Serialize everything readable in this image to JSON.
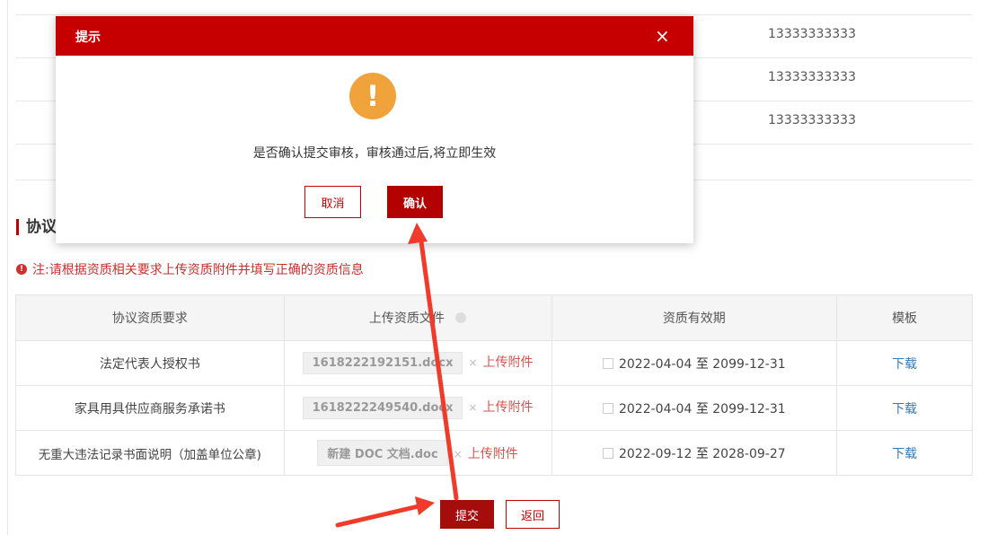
{
  "phones": [
    "13333333333",
    "13333333333",
    "13333333333"
  ],
  "section_title": "协议",
  "note": "注:请根据资质相关要求上传资质附件并填写正确的资质信息",
  "table": {
    "headers": [
      "协议资质要求",
      "上传资质文件",
      "资质有效期",
      "模板"
    ],
    "rows": [
      {
        "req": "法定代表人授权书",
        "file": "1618222192151.docx",
        "upload": "上传附件",
        "from": "2022-04-04",
        "to": "2099-12-31",
        "dl": "下载"
      },
      {
        "req": "家具用具供应商服务承诺书",
        "file": "1618222249540.docx",
        "upload": "上传附件",
        "from": "2022-04-04",
        "to": "2099-12-31",
        "dl": "下载"
      },
      {
        "req": "无重大违法记录书面说明（加盖单位公章)",
        "file": "新建 DOC 文档.doc",
        "upload": "上传附件",
        "from": "2022-09-12",
        "to": "2028-09-27",
        "dl": "下载"
      }
    ],
    "date_sep": "至"
  },
  "buttons": {
    "submit": "提交",
    "back": "返回"
  },
  "modal": {
    "title": "提示",
    "close": "×",
    "icon": "!",
    "message": "是否确认提交审核，审核通过后,将立即生效",
    "cancel": "取消",
    "confirm": "确认"
  },
  "colors": {
    "primary": "#c60000",
    "warning": "#f0a33a",
    "link": "#337ab7",
    "arrow": "#f03a2a"
  }
}
